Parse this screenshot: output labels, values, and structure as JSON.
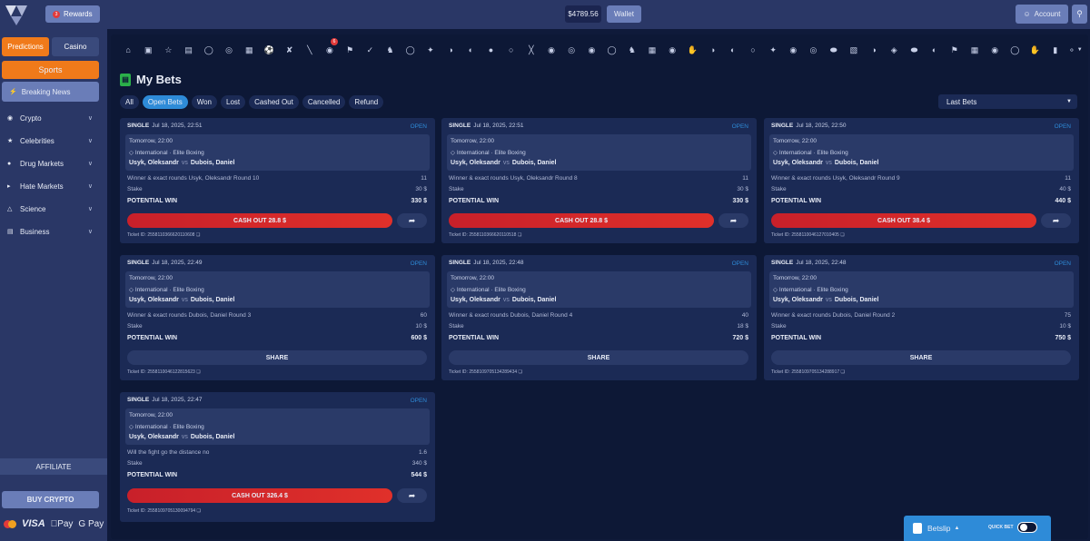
{
  "topbar": {
    "rewards": "Rewards",
    "rewards_badge": "3",
    "balance": "$4789.56",
    "wallet": "Wallet",
    "account": "Account"
  },
  "sidebar": {
    "tab_predictions": "Predictions",
    "tab_casino": "Casino",
    "sports": "Sports",
    "breaking_news": "Breaking News",
    "items": [
      {
        "label": "Crypto",
        "icon": "crypto-icon"
      },
      {
        "label": "Celebrities",
        "icon": "star-icon"
      },
      {
        "label": "Drug Markets",
        "icon": "pill-icon"
      },
      {
        "label": "Hate Markets",
        "icon": "megaphone-icon"
      },
      {
        "label": "Science",
        "icon": "flask-icon"
      },
      {
        "label": "Business",
        "icon": "chart-icon"
      }
    ],
    "affiliate": "AFFILIATE",
    "buy_crypto": "BUY CRYPTO",
    "payments": {
      "visa": "VISA",
      "apple": "Pay",
      "google": "G Pay"
    }
  },
  "sportbar": {
    "badge": "6"
  },
  "page": {
    "title": "My Bets",
    "last_bets": "Last Bets"
  },
  "filters": [
    "All",
    "Open Bets",
    "Won",
    "Lost",
    "Cashed Out",
    "Cancelled",
    "Refund"
  ],
  "bets": [
    {
      "type": "SINGLE",
      "date": "Jul 18, 2025, 22:51",
      "status": "OPEN",
      "time": "Tomorrow, 22:00",
      "league": "International · Elite Boxing",
      "home": "Usyk, Oleksandr",
      "vs": "vs",
      "away": "Dubois, Daniel",
      "market": "Winner & exact rounds Usyk, Oleksandr Round 10",
      "odds": "11",
      "stake_label": "Stake",
      "stake": "30 $",
      "win_label": "POTENTIAL WIN",
      "win": "330 $",
      "cashout": "CASH OUT 28.8 $",
      "ticket": "Ticket ID: 2558110366620110608"
    },
    {
      "type": "SINGLE",
      "date": "Jul 18, 2025, 22:51",
      "status": "OPEN",
      "time": "Tomorrow, 22:00",
      "league": "International · Elite Boxing",
      "home": "Usyk, Oleksandr",
      "vs": "vs",
      "away": "Dubois, Daniel",
      "market": "Winner & exact rounds Usyk, Oleksandr Round 8",
      "odds": "11",
      "stake_label": "Stake",
      "stake": "30 $",
      "win_label": "POTENTIAL WIN",
      "win": "330 $",
      "cashout": "CASH OUT 28.8 $",
      "ticket": "Ticket ID: 2558110366620110518"
    },
    {
      "type": "SINGLE",
      "date": "Jul 18, 2025, 22:50",
      "status": "OPEN",
      "time": "Tomorrow, 22:00",
      "league": "International · Elite Boxing",
      "home": "Usyk, Oleksandr",
      "vs": "vs",
      "away": "Dubois, Daniel",
      "market": "Winner & exact rounds Usyk, Oleksandr Round 9",
      "odds": "11",
      "stake_label": "Stake",
      "stake": "40 $",
      "win_label": "POTENTIAL WIN",
      "win": "440 $",
      "cashout": "CASH OUT 38.4 $",
      "ticket": "Ticket ID: 2558110046127010405"
    },
    {
      "type": "SINGLE",
      "date": "Jul 18, 2025, 22:49",
      "status": "OPEN",
      "time": "Tomorrow, 22:00",
      "league": "International · Elite Boxing",
      "home": "Usyk, Oleksandr",
      "vs": "vs",
      "away": "Dubois, Daniel",
      "market": "Winner & exact rounds Dubois, Daniel Round 3",
      "odds": "60",
      "stake_label": "Stake",
      "stake": "10 $",
      "win_label": "POTENTIAL WIN",
      "win": "600 $",
      "share": "SHARE",
      "ticket": "Ticket ID: 2558110046122815623"
    },
    {
      "type": "SINGLE",
      "date": "Jul 18, 2025, 22:48",
      "status": "OPEN",
      "time": "Tomorrow, 22:00",
      "league": "International · Elite Boxing",
      "home": "Usyk, Oleksandr",
      "vs": "vs",
      "away": "Dubois, Daniel",
      "market": "Winner & exact rounds Dubois, Daniel Round 4",
      "odds": "40",
      "stake_label": "Stake",
      "stake": "18 $",
      "win_label": "POTENTIAL WIN",
      "win": "720 $",
      "share": "SHARE",
      "ticket": "Ticket ID: 2558109705134289434"
    },
    {
      "type": "SINGLE",
      "date": "Jul 18, 2025, 22:48",
      "status": "OPEN",
      "time": "Tomorrow, 22:00",
      "league": "International · Elite Boxing",
      "home": "Usyk, Oleksandr",
      "vs": "vs",
      "away": "Dubois, Daniel",
      "market": "Winner & exact rounds Dubois, Daniel Round 2",
      "odds": "75",
      "stake_label": "Stake",
      "stake": "10 $",
      "win_label": "POTENTIAL WIN",
      "win": "750 $",
      "share": "SHARE",
      "ticket": "Ticket ID: 2558109705134288917"
    },
    {
      "type": "SINGLE",
      "date": "Jul 18, 2025, 22:47",
      "status": "OPEN",
      "time": "Tomorrow, 22:00",
      "league": "International · Elite Boxing",
      "home": "Usyk, Oleksandr",
      "vs": "vs",
      "away": "Dubois, Daniel",
      "market": "Will the fight go the distance no",
      "odds": "1.6",
      "stake_label": "Stake",
      "stake": "340 $",
      "win_label": "POTENTIAL WIN",
      "win": "544 $",
      "cashout": "CASH OUT 326.4 $",
      "ticket": "Ticket ID: 2558109705130094794"
    }
  ],
  "betslip": {
    "label": "Betslip",
    "quick_bet": "QUICK BET"
  },
  "colors": {
    "accent": "#f07a1a",
    "blue": "#2e8bd8",
    "cashout": "#d0282a"
  }
}
